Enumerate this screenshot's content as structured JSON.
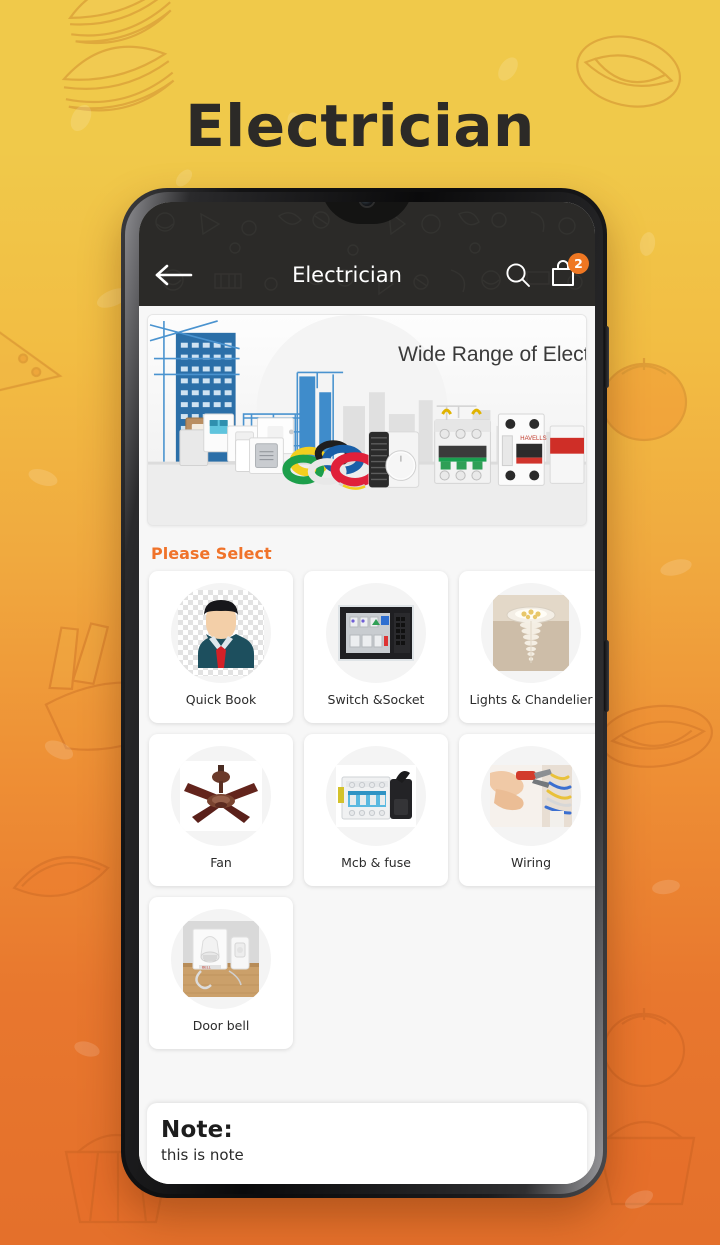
{
  "promo": {
    "title": "Electrician",
    "background_top_color": "#f0c94a",
    "background_bottom_color": "#e4702b"
  },
  "appbar": {
    "back_icon": "back-arrow-icon",
    "title": "Electrician",
    "search_icon": "search-icon",
    "cart_icon": "shopping-bag-icon",
    "cart_badge": "2",
    "badge_color": "#ef7722",
    "background_color": "#2b2a28"
  },
  "banner": {
    "headline": "Wide Range of Electrical",
    "alt": "electrical products with blue city skyline"
  },
  "section": {
    "title": "Please Select",
    "title_color": "#f0732a"
  },
  "categories": [
    {
      "label": "Quick Book",
      "icon": "businessman-avatar-icon"
    },
    {
      "label": "Switch &Socket",
      "icon": "switch-panel-icon"
    },
    {
      "label": "Lights & Chandelier",
      "icon": "chandelier-icon"
    },
    {
      "label": "Fan",
      "icon": "ceiling-fan-icon"
    },
    {
      "label": "Mcb & fuse",
      "icon": "mcb-fuse-icon"
    },
    {
      "label": "Wiring",
      "icon": "wiring-hand-icon"
    },
    {
      "label": "Door bell",
      "icon": "doorbell-icon"
    }
  ],
  "note": {
    "heading": "Note:",
    "body": "this is note"
  }
}
